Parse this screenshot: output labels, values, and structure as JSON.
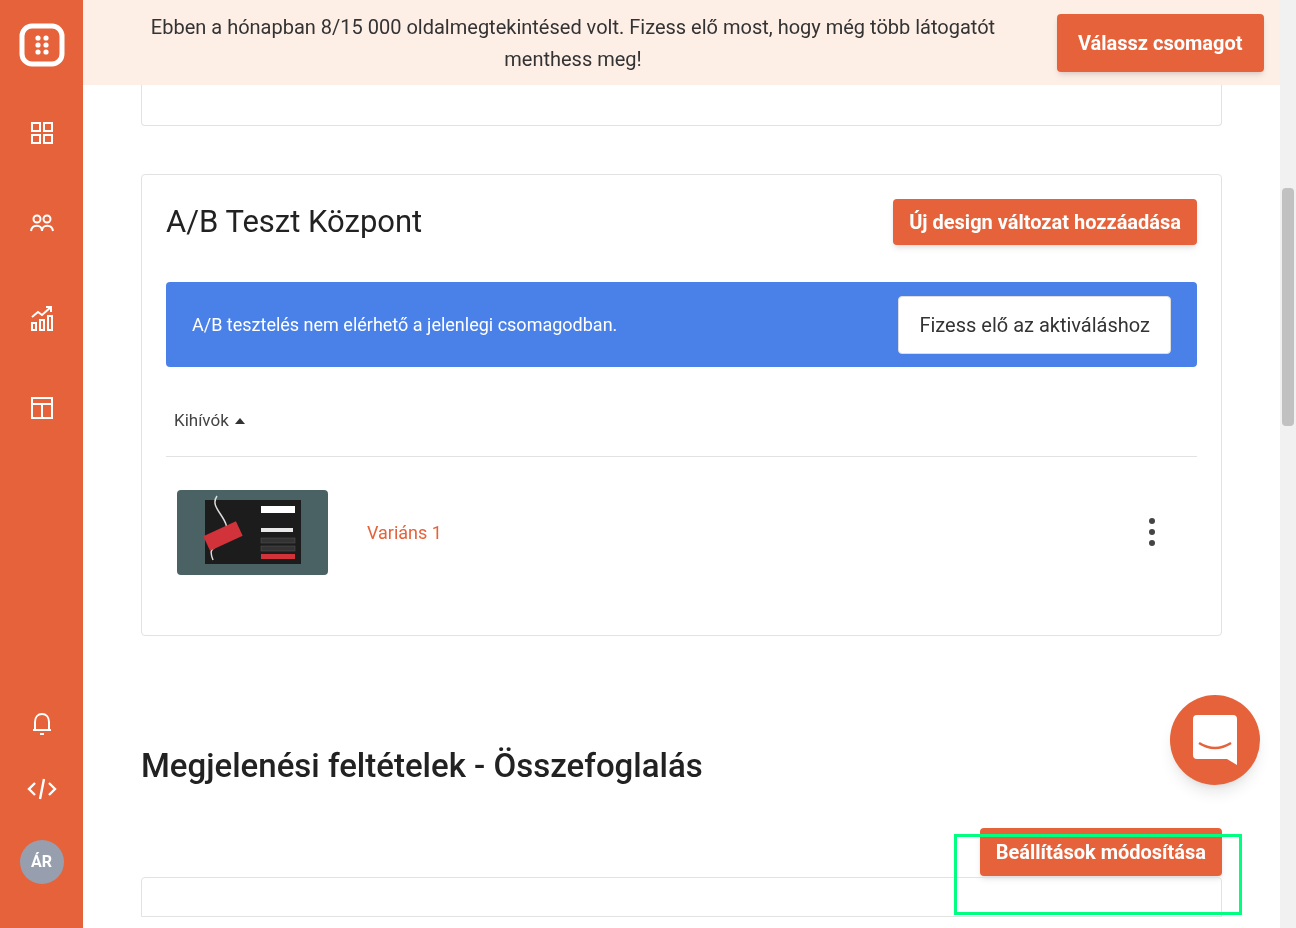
{
  "sidebar": {
    "avatar": "ÁR"
  },
  "banner": {
    "text": "Ebben a hónapban 8/15 000 oldalmegtekintésed volt. Fizess elő most, hogy még több látogatót menthess meg!",
    "button": "Válassz csomagot"
  },
  "ab_test": {
    "title": "A/B Teszt Központ",
    "add_button": "Új design változat hozzáadása",
    "notice": {
      "text": "A/B tesztelés nem elérhető a jelenlegi csomagodban.",
      "button": "Fizess elő az aktiváláshoz"
    },
    "column": {
      "label": "Kihívók",
      "sorted_ascending": true
    },
    "rows": [
      {
        "name": "Variáns 1"
      }
    ]
  },
  "conditions": {
    "title": "Megjelenési feltételek - Összefoglalás",
    "button": "Beállítások módosítása",
    "highlighted": true
  }
}
